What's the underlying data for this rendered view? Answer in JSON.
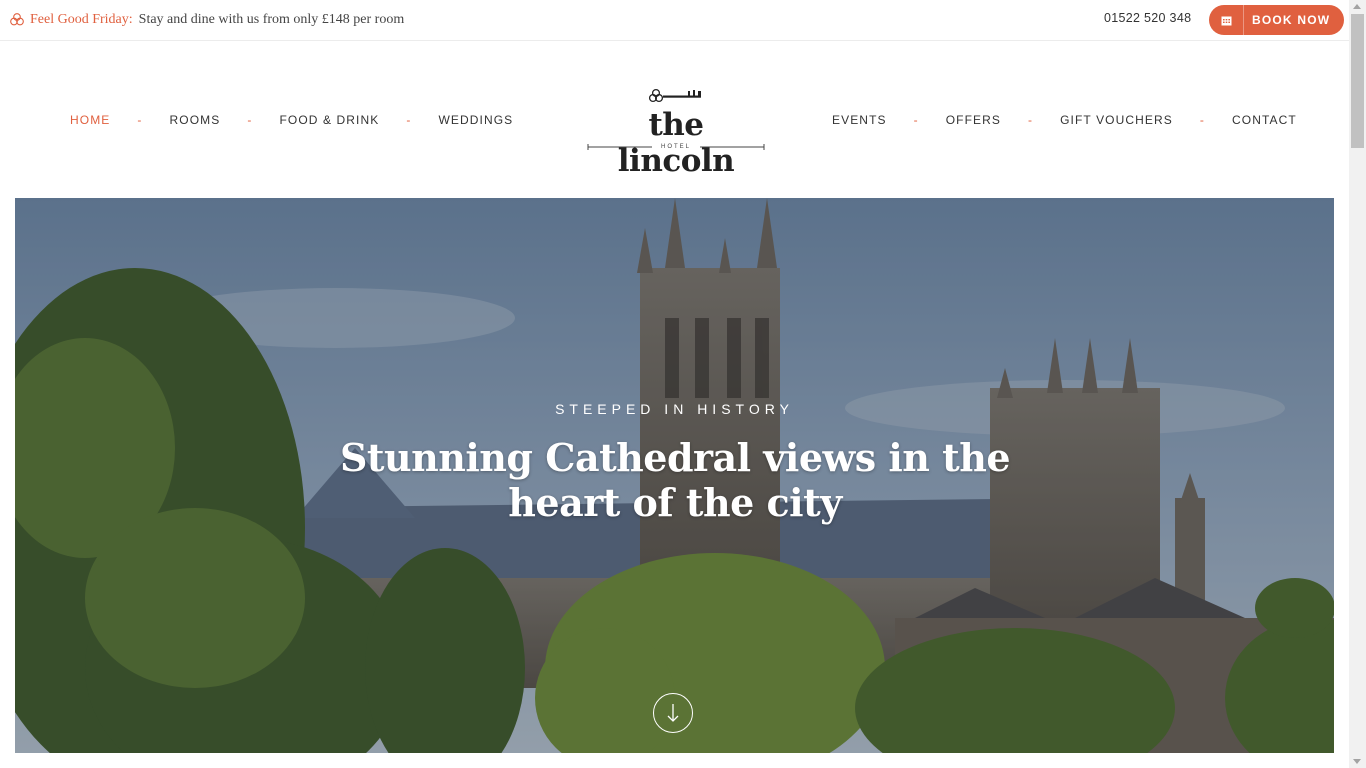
{
  "promo": {
    "label": "Feel Good Friday:",
    "text": "Stay and dine with us from only £148 per room",
    "icon": "flower-icon"
  },
  "header": {
    "phone": "01522 520 348",
    "book_label": "BOOK NOW",
    "book_icon": "calendar-icon"
  },
  "nav": {
    "left": [
      "HOME",
      "ROOMS",
      "FOOD & DRINK",
      "WEDDINGS"
    ],
    "right": [
      "EVENTS",
      "OFFERS",
      "GIFT VOUCHERS",
      "CONTACT"
    ],
    "separator": "-",
    "active": "HOME"
  },
  "logo": {
    "name": "the lincoln",
    "sub": "HOTEL",
    "icon": "key-icon"
  },
  "hero": {
    "kicker": "STEEPED IN HISTORY",
    "title": "Stunning Cathedral views in the heart of the city",
    "scroll_icon": "arrow-down-icon"
  },
  "colors": {
    "accent": "#e0603f",
    "text": "#333333"
  }
}
